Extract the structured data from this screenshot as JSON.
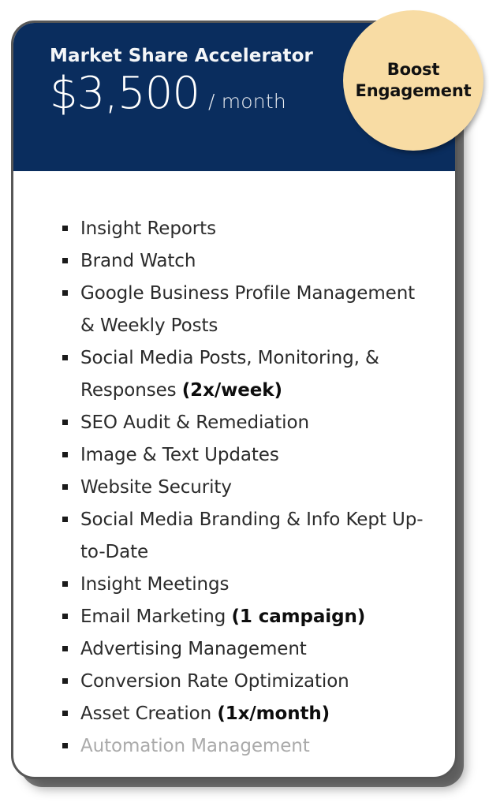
{
  "card": {
    "accent_navy": "#0A2D5E",
    "badge_color": "#F8DCA4",
    "border_color": "#575757",
    "muted_text_color": "#AAAAAA"
  },
  "header": {
    "plan_title": "Market Share Accelerator",
    "price_amount": "$3,500",
    "price_period": "/ month"
  },
  "badge": {
    "line1": "Boost",
    "line2": "Engagement"
  },
  "features": [
    {
      "text": "Insight Reports",
      "bold": "",
      "muted": false
    },
    {
      "text": "Brand Watch",
      "bold": "",
      "muted": false
    },
    {
      "text": "Google Business Profile Management & Weekly Posts",
      "bold": "",
      "muted": false
    },
    {
      "text": "Social Media Posts, Monitoring, & Responses ",
      "bold": "(2x/week)",
      "muted": false
    },
    {
      "text": "SEO Audit & Remediation",
      "bold": "",
      "muted": false
    },
    {
      "text": "Image & Text Updates",
      "bold": "",
      "muted": false
    },
    {
      "text": "Website Security",
      "bold": "",
      "muted": false
    },
    {
      "text": "Social Media Branding & Info Kept Up-to-Date",
      "bold": "",
      "muted": false
    },
    {
      "text": "Insight Meetings",
      "bold": "",
      "muted": false
    },
    {
      "text": "Email Marketing ",
      "bold": "(1 campaign)",
      "muted": false
    },
    {
      "text": "Advertising Management",
      "bold": "",
      "muted": false
    },
    {
      "text": "Conversion Rate Optimization",
      "bold": "",
      "muted": false
    },
    {
      "text": "Asset Creation ",
      "bold": "(1x/month)",
      "muted": false
    },
    {
      "text": "Automation Management",
      "bold": "",
      "muted": true
    }
  ]
}
